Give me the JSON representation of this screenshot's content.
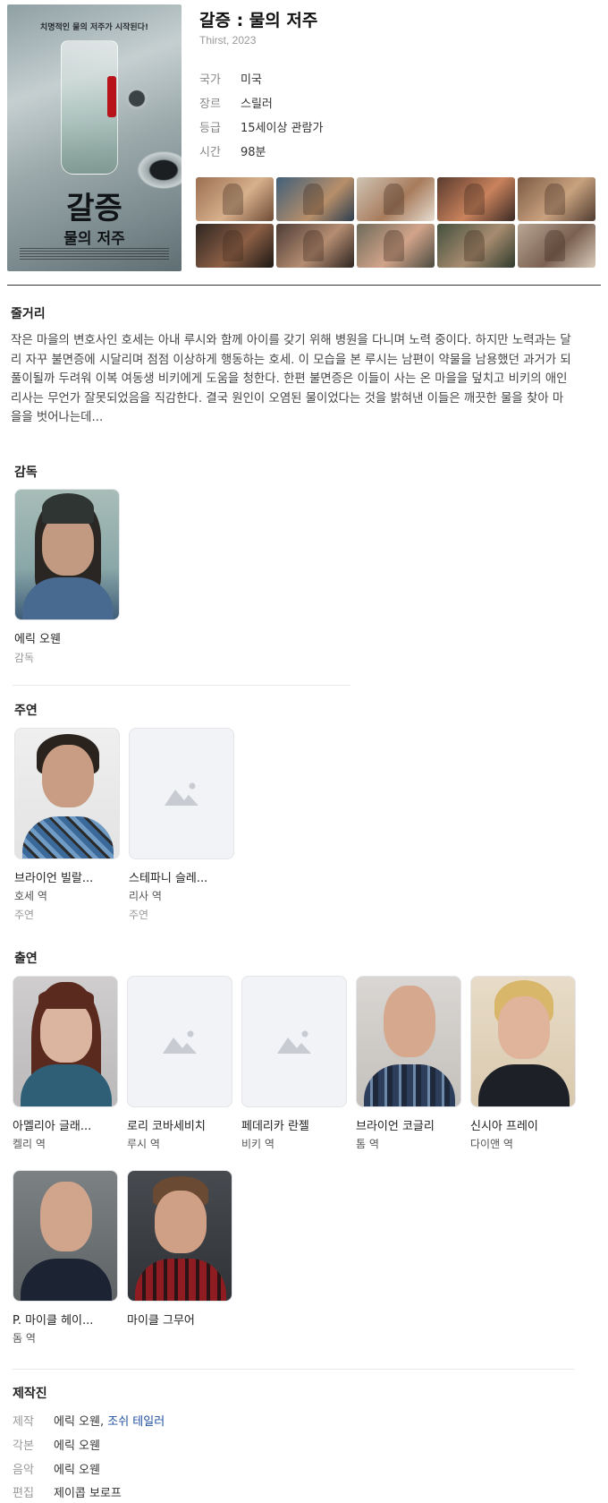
{
  "poster": {
    "tagline": "치명적인 물의 저주가 시작된다!",
    "title": "갈증",
    "subtitle": "물의 저주"
  },
  "movie": {
    "title": "갈증 : 물의 저주",
    "original": "Thirst, 2023"
  },
  "info": [
    {
      "key": "국가",
      "value": "미국"
    },
    {
      "key": "장르",
      "value": "스릴러"
    },
    {
      "key": "등급",
      "value": "15세이상 관람가"
    },
    {
      "key": "시간",
      "value": "98분"
    }
  ],
  "synopsis": {
    "heading": "줄거리",
    "text": "작은 마을의 변호사인 호세는 아내 루시와 함께 아이를 갖기 위해 병원을 다니며 노력 중이다. 하지만 노력과는 달리 자꾸 불면증에 시달리며 점점 이상하게 행동하는 호세. 이 모습을 본 루시는 남편이 약물을 남용했던 과거가 되풀이될까 두려워 이복 여동생 비키에게 도움을 청한다. 한편 불면증은 이들이 사는 온 마을을 덮치고 비키의 애인 리사는 무언가 잘못되었음을 직감한다. 결국 원인이 오염된 물이었다는 것을 밝혀낸 이들은 깨끗한 물을 찾아 마을을 벗어나는데..."
  },
  "director": {
    "heading": "감독",
    "people": [
      {
        "name": "에릭 오웬",
        "type": "감독"
      }
    ]
  },
  "lead": {
    "heading": "주연",
    "people": [
      {
        "name": "브라이언 빌랄...",
        "role": "호세 역",
        "type": "주연"
      },
      {
        "name": "스테파니 슬레...",
        "role": "리사 역",
        "type": "주연"
      }
    ]
  },
  "cast": {
    "heading": "출연",
    "people": [
      {
        "name": "아멜리아 글래...",
        "role": "켈리 역"
      },
      {
        "name": "로리 코바세비치",
        "role": "루시 역"
      },
      {
        "name": "페데리카 란젤",
        "role": "비키 역"
      },
      {
        "name": "브라이언 코글리",
        "role": "톰 역"
      },
      {
        "name": "신시아 프레이",
        "role": "다이앤 역"
      },
      {
        "name": "P. 마이클 헤이...",
        "role": "돔 역"
      },
      {
        "name": "마이클 그무어",
        "role": ""
      }
    ]
  },
  "crew": {
    "heading": "제작진",
    "rows": [
      {
        "key": "제작",
        "value_a": "에릭 오웬, ",
        "value_b": "조쉬 테일러"
      },
      {
        "key": "각본",
        "value_a": "에릭 오웬",
        "value_b": ""
      },
      {
        "key": "음악",
        "value_a": "에릭 오웬",
        "value_b": ""
      },
      {
        "key": "편집",
        "value_a": "제이콥 보로프",
        "value_b": ""
      }
    ]
  },
  "colors": {
    "link": "#1f4fa0",
    "placeholder_bg": "#f2f3f6",
    "placeholder_icon": "#c8cbd2"
  },
  "icons": {
    "placeholder": "image-placeholder-icon"
  }
}
